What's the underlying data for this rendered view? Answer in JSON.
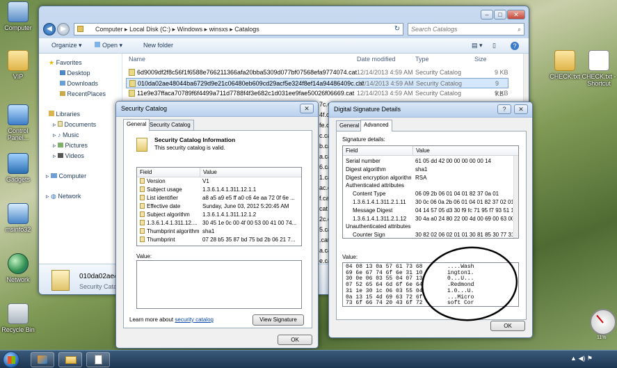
{
  "desktop": {
    "icons": [
      {
        "label": "Computer"
      },
      {
        "label": "VIP"
      },
      {
        "label": "Control Panel..."
      },
      {
        "label": "Gadgets"
      },
      {
        "label": "msinfo32"
      },
      {
        "label": "Network"
      },
      {
        "label": "Recycle Bin"
      },
      {
        "label": "CHECK.txt"
      },
      {
        "label": "CHECK.txt - Shortcut"
      }
    ]
  },
  "explorer": {
    "breadcrumb": [
      "Computer",
      "Local Disk (C:)",
      "Windows",
      "winsxs",
      "Catalogs"
    ],
    "search_placeholder": "Search Catalogs",
    "toolbar": {
      "organize": "Organize",
      "open": "Open",
      "new_folder": "New folder"
    },
    "nav": {
      "favorites": "Favorites",
      "fav_items": [
        "Desktop",
        "Downloads",
        "RecentPlaces"
      ],
      "libraries": "Libraries",
      "lib_items": [
        "Documents",
        "Music",
        "Pictures",
        "Videos"
      ],
      "computer": "Computer",
      "network": "Network"
    },
    "columns": {
      "name": "Name",
      "date": "Date modified",
      "type": "Type",
      "size": "Size"
    },
    "files": [
      {
        "name": "6d9009df2f8c56f1f6588e766211366afa20bba5309d077bf07568efa9774074.cat",
        "date": "12/14/2013 4:59 AM",
        "type": "Security Catalog",
        "size": "9 KB"
      },
      {
        "name": "010da02ae48044ba6729d9e21c06480eb609cd29acf5e324f8ef14a94486409c.cat",
        "date": "12/14/2013 4:59 AM",
        "type": "Security Catalog",
        "size": "9 KB"
      },
      {
        "name": "11e9e37ffaca70789f6f4499a711d7788f4f3e682c1d031ee9fae50026f06669.cat",
        "date": "12/14/2013 4:59 AM",
        "type": "Security Catalog",
        "size": "9 KB"
      }
    ],
    "partial_names": [
      "7c.cat",
      "4f.cat",
      "fe.cat",
      "c.cat",
      "b.cat",
      "a.cat",
      "6.cat",
      "1.cat",
      "ac.cat",
      "f.cat",
      "cat",
      "2c.cat",
      "5.cat",
      ".cat",
      "a.cat",
      "e.cat"
    ],
    "details": {
      "name": "010da02ae48",
      "type": "Security Catalo"
    }
  },
  "security_catalog": {
    "title": "Security Catalog",
    "tabs": [
      "General",
      "Security Catalog"
    ],
    "info_title": "Security Catalog Information",
    "info_sub": "This security catalog is valid.",
    "columns": {
      "field": "Field",
      "value": "Value"
    },
    "rows": [
      {
        "field": "Version",
        "value": "V1"
      },
      {
        "field": "Subject usage",
        "value": "1.3.6.1.4.1.311.12.1.1"
      },
      {
        "field": "List identifier",
        "value": "a8 a5 a9 e5 ff a0 c6 4e aa 72 0f 6e ..."
      },
      {
        "field": "Effective date",
        "value": "Sunday, June 03, 2012 5:20:45 AM"
      },
      {
        "field": "Subject algorithm",
        "value": "1.3.6.1.4.1.311.12.1.2"
      },
      {
        "field": "1.3.6.1.4.1.311.12....",
        "value": "30 45 1e 0c 00 4f 00 53 00 41 00 74..."
      },
      {
        "field": "Thumbprint algorithm",
        "value": "sha1"
      },
      {
        "field": "Thumbprint",
        "value": "07 28 b5 35 87 bd 75 bd 2b 06 21 7..."
      }
    ],
    "value_label": "Value:",
    "learn_more": "Learn more about",
    "learn_link": "security catalog",
    "view_signature": "View Signature",
    "ok": "OK"
  },
  "digital_signature": {
    "title": "Digital Signature Details",
    "tabs": [
      "General",
      "Advanced"
    ],
    "sig_label": "Signature details:",
    "columns": {
      "field": "Field",
      "value": "Value"
    },
    "rows": [
      {
        "field": "Serial number",
        "value": "61 05 dd 42 00 00 00 00 00 14",
        "indent": 0
      },
      {
        "field": "Digest algorithm",
        "value": "sha1",
        "indent": 0
      },
      {
        "field": "Digest encryption algorithm",
        "value": "RSA",
        "indent": 0
      },
      {
        "field": "Authenticated attributes",
        "value": "",
        "indent": 0
      },
      {
        "field": "Content Type",
        "value": "06 09 2b 06 01 04 01 82 37 0a 01",
        "indent": 1
      },
      {
        "field": "1.3.6.1.4.1.311.2.1.11",
        "value": "30 0c 06 0a 2b 06 01 04 01 82 37 02 01",
        "indent": 1
      },
      {
        "field": "Message Digest",
        "value": "04 14 57 05 d3 30 f9 fc 71 95 f7 93 51 1",
        "indent": 1
      },
      {
        "field": "1.3.6.1.4.1.311.2.1.12",
        "value": "30 4a a0 24 80 22 00 4d 00 69 00 63 00.",
        "indent": 1
      },
      {
        "field": "Unauthenticated attributes",
        "value": "",
        "indent": 0
      },
      {
        "field": "Counter Sign",
        "value": "30 82 02 06 02 01 01 30 81 85 30 77 31",
        "indent": 1
      }
    ],
    "value_label": "Value:",
    "hex_lines": [
      "04 08 13 0a 57 61 73 68",
      "69 6e 67 74 6f 6e 31 10",
      "30 0e 06 03 55 04 07 13",
      "07 52 65 64 6d 6f 6e 64",
      "31 1e 30 1c 06 03 55 04",
      "0a 13 15 4d 69 63 72 6f",
      "73 6f 66 74 20 43 6f 72"
    ],
    "ascii_lines": [
      "....Wash",
      "ington1.",
      "0...U...",
      ".Redmond",
      "1.0...U.",
      "...Micro",
      "soft Cor"
    ],
    "ok": "OK"
  },
  "taskbar": {
    "clock": "11%"
  }
}
